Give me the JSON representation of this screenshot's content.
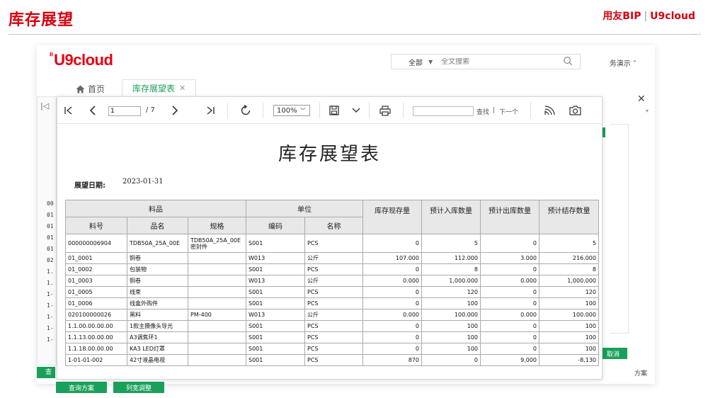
{
  "slide": {
    "title": "库存展望",
    "brand_left": "用友BIP",
    "brand_sep": "|",
    "brand_right": "U9cloud"
  },
  "app": {
    "logo": "U9cloud",
    "search": {
      "scope": "全部",
      "placeholder": "全文搜索"
    },
    "user_menu": "务演示 ˅",
    "tabs": {
      "home": "首页",
      "active": "库存展望表"
    },
    "left_codes": [
      "00",
      "01",
      "01",
      "01",
      "01",
      "02",
      "1.",
      "1.",
      "1-",
      "1-",
      "1-",
      "1-",
      "1-"
    ],
    "cancel_label": "取消",
    "scheme_label": "方案",
    "left_btn_label": "查"
  },
  "viewer": {
    "page_current": "1",
    "page_total": "/ 7",
    "zoom": "100%",
    "find_label": "查找",
    "find_sep": "|",
    "find_next": "下一个"
  },
  "report": {
    "title": "库存展望表",
    "date_label": "展望日期:",
    "date_value": "2023-01-31",
    "group_headers": [
      "料品",
      "单位",
      "库存现存量",
      "预计入库数量",
      "预计出库数量",
      "预计结存数量"
    ],
    "sub_headers": [
      "料号",
      "品名",
      "规格",
      "编码",
      "名称"
    ],
    "rows": [
      [
        "000000006904",
        "TDB50A_25A_00E",
        "TDB50A_25A_00E密封件",
        "S001",
        "PCS",
        "0",
        "5",
        "0",
        "5"
      ],
      [
        "01_0001",
        "铜卷",
        "",
        "W013",
        "公斤",
        "107.000",
        "112.000",
        "3.000",
        "216.000"
      ],
      [
        "01_0002",
        "包装物",
        "",
        "S001",
        "PCS",
        "0",
        "8",
        "0",
        "8"
      ],
      [
        "01_0003",
        "铜卷",
        "",
        "W013",
        "公斤",
        "0.000",
        "1,000.000",
        "0.000",
        "1,000.000"
      ],
      [
        "01_0005",
        "线束",
        "",
        "S001",
        "PCS",
        "0",
        "120",
        "0",
        "120"
      ],
      [
        "01_0006",
        "线盒外购件",
        "",
        "S001",
        "PCS",
        "0",
        "100",
        "0",
        "100"
      ],
      [
        "020100000026",
        "黑料",
        "PM-400",
        "W013",
        "公斤",
        "0.000",
        "100.000",
        "0.000",
        "100.000"
      ],
      [
        "1.1.00.00.00.00",
        "1款主摄像头导光",
        "",
        "S001",
        "PCS",
        "0",
        "100",
        "0",
        "100"
      ],
      [
        "1.1.13.00.00.00",
        "A3调焦环1",
        "",
        "S001",
        "PCS",
        "0",
        "100",
        "0",
        "100"
      ],
      [
        "1.1.18.00.00.00",
        "KA3 LED灯罩",
        "",
        "S001",
        "PCS",
        "0",
        "100",
        "0",
        "100"
      ],
      [
        "1-01-01-002",
        "42寸液晶电视",
        "",
        "S001",
        "PCS",
        "870",
        "0",
        "9,000",
        "-8,130"
      ]
    ]
  },
  "buttons": {
    "query_scheme": "查询方案",
    "column_adjust": "列宽调整"
  }
}
